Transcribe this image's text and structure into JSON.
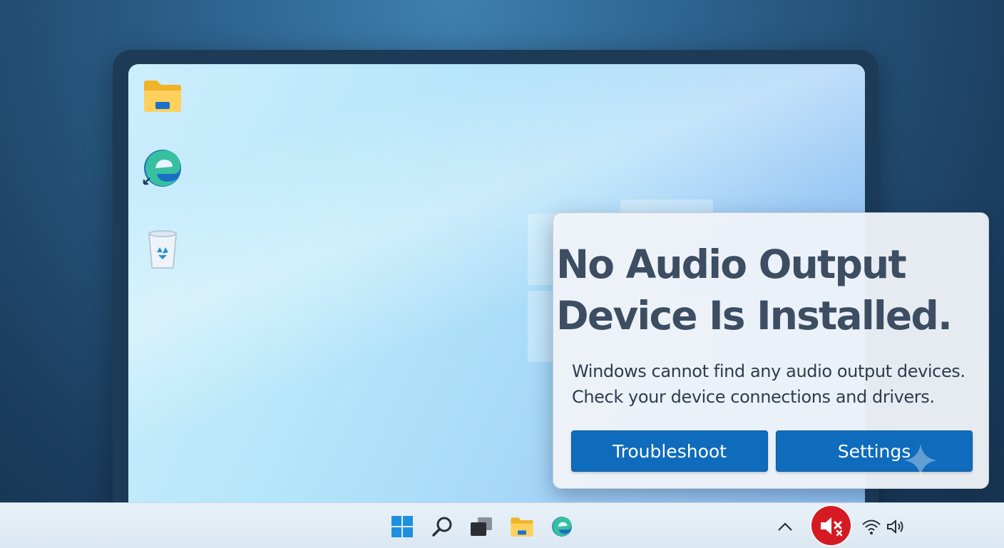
{
  "desktop": {
    "icons": [
      {
        "name": "file-explorer"
      },
      {
        "name": "microsoft-edge"
      },
      {
        "name": "recycle-bin"
      }
    ]
  },
  "dialog": {
    "title": "No Audio Output\nDevice Is Installed.",
    "body_line1": "Windows cannot find any audio output devices.",
    "body_line2": "Check your device connections and drivers.",
    "troubleshoot_label": "Troubleshoot",
    "settings_label": "Settings"
  },
  "taskbar": {
    "pinned": [
      "start",
      "search",
      "task-view",
      "file-explorer",
      "edge"
    ],
    "tray": [
      "show-hidden-icons",
      "volume-muted",
      "wifi",
      "speaker"
    ]
  },
  "colors": {
    "accent": "#0f6cbd",
    "mute_badge": "#d51a23",
    "title_text": "#3d4d62"
  }
}
